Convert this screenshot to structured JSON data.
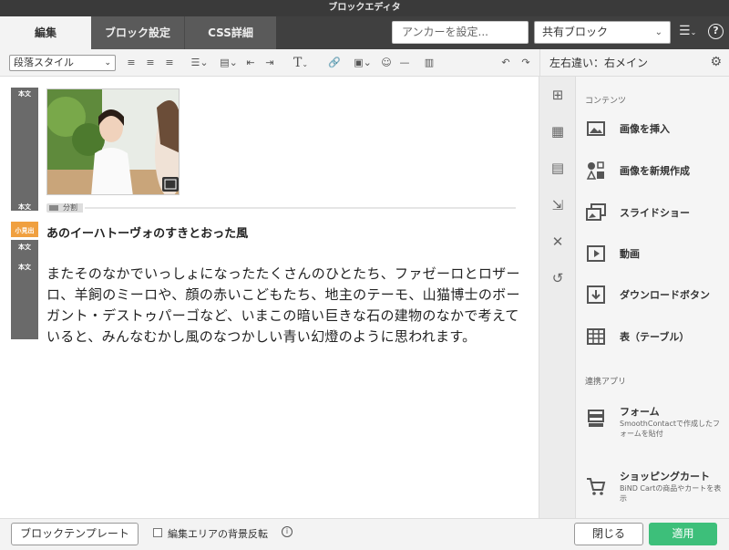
{
  "window": {
    "title": "ブロックエディタ"
  },
  "tabs": [
    {
      "label": "編集",
      "active": true
    },
    {
      "label": "ブロック設定",
      "active": false
    },
    {
      "label": "CSS詳細",
      "active": false
    }
  ],
  "header": {
    "anchor_placeholder": "アンカーを設定...",
    "shared_block_label": "共有ブロック"
  },
  "toolbar": {
    "paragraph_style": "段落スタイル"
  },
  "sidebar": {
    "title": "左右違い：右メイン",
    "sections": [
      {
        "label": "コンテンツ"
      },
      {
        "label": "連携アプリ"
      }
    ],
    "content_items": [
      {
        "label": "画像を挿入",
        "icon": "image-insert-icon"
      },
      {
        "label": "画像を新規作成",
        "icon": "shapes-icon"
      },
      {
        "label": "スライドショー",
        "icon": "slideshow-icon"
      },
      {
        "label": "動画",
        "icon": "video-icon"
      },
      {
        "label": "ダウンロードボタン",
        "icon": "download-icon"
      },
      {
        "label": "表（テーブル）",
        "icon": "table-icon"
      }
    ],
    "app_items": [
      {
        "label": "フォーム",
        "desc": "SmoothContactで作成したフォームを貼付",
        "icon": "form-icon"
      },
      {
        "label": "ショッピングカート",
        "desc": "BiND Cartの商品やカートを表示",
        "icon": "cart-icon"
      }
    ]
  },
  "editor": {
    "tags": {
      "body": "本文",
      "subheading": "小見出"
    },
    "divider_label": "分割",
    "heading": "あのイーハトーヴォのすきとおった風",
    "paragraph": "またそのなかでいっしょになったたくさんのひとたち、ファゼーロとロザーロ、羊飼のミーロや、顔の赤いこどもたち、地主のテーモ、山猫博士のボーガント・デストゥパーゴなど、いまこの暗い巨きな石の建物のなかで考えていると、みんなむかし風のなつかしい青い幻燈のように思われます。"
  },
  "footer": {
    "template_button": "ブロックテンプレート",
    "invert_bg_label": "編集エリアの背景反転",
    "close_button": "閉じる",
    "apply_button": "適用"
  },
  "colors": {
    "subheading_tag": "#f0a040",
    "apply": "#3dbf7a",
    "tabbar": "#404040"
  }
}
